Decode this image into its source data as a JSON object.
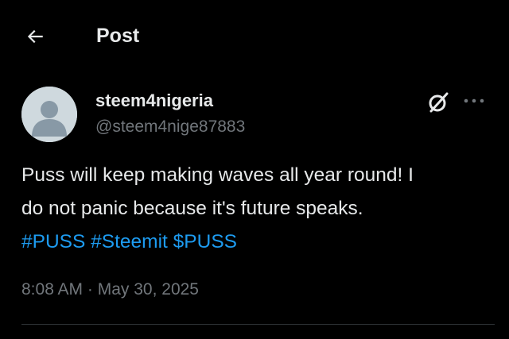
{
  "header": {
    "title": "Post",
    "back_icon": "arrow-left-icon"
  },
  "post": {
    "author": {
      "display_name": "steem4nigeria",
      "handle": "@steem4nige87883",
      "avatar": "default-avatar-icon"
    },
    "actions": {
      "grok_icon": "grok-icon",
      "more_icon": "more-horizontal-icon"
    },
    "text": {
      "line1": "Puss will keep making waves all year round! I",
      "line2": "do not panic because it's future speaks.",
      "hashtags": [
        "#PUSS",
        "#Steemit",
        "$PUSS"
      ]
    },
    "timestamp": {
      "time": "8:08 AM",
      "separator": " · ",
      "date": "May 30, 2025"
    }
  },
  "colors": {
    "background": "#000000",
    "text_primary": "#e7e9ea",
    "text_secondary": "#71767b",
    "link": "#1d9bf0",
    "divider": "#2f3336",
    "avatar_bg": "#cfd9de",
    "avatar_fg": "#8899a6"
  }
}
